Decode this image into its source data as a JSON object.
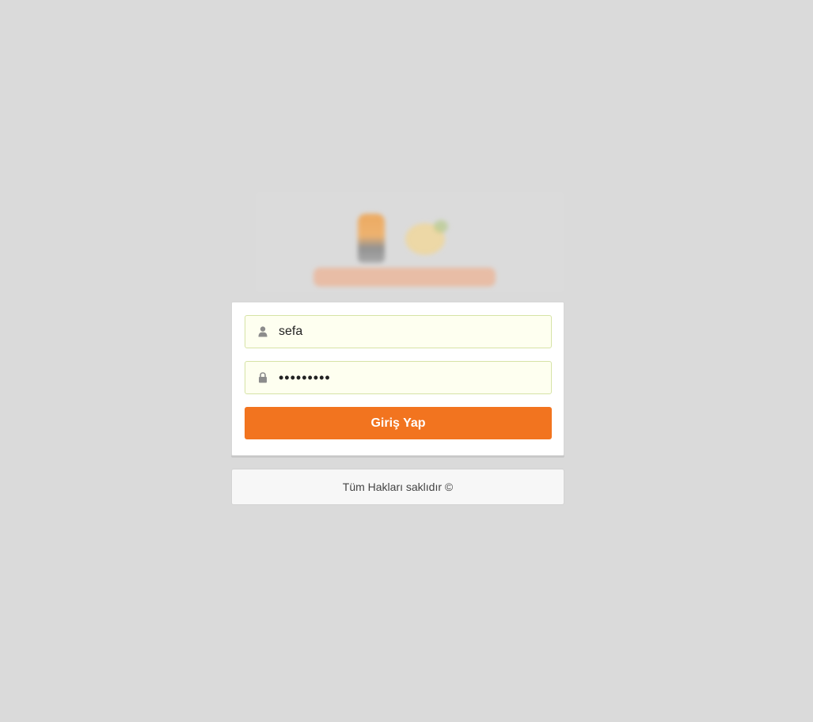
{
  "login": {
    "username_value": "sefa",
    "password_value": "•••••••••",
    "submit_label": "Giriş Yap"
  },
  "icons": {
    "username": "user-icon",
    "password": "lock-icon"
  },
  "footer": {
    "copyright": "Tüm Hakları saklıdır ©"
  },
  "colors": {
    "background": "#dadada",
    "accent": "#f2741f",
    "field_background": "#fefff0"
  }
}
